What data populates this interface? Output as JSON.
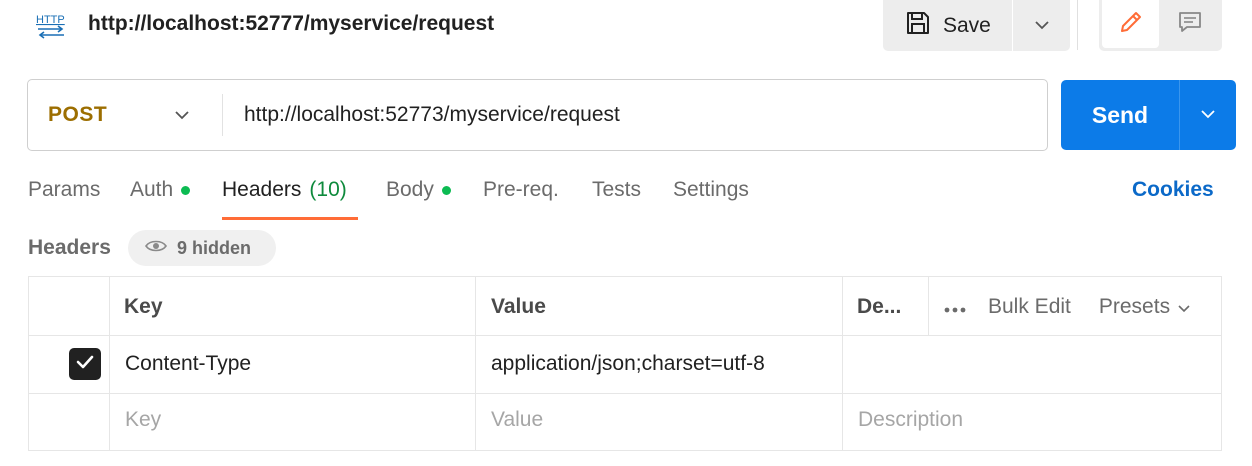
{
  "top": {
    "icon": "http-request-icon",
    "icon_text": "HTTP",
    "title": "http://localhost:52777/myservice/request",
    "save_label": "Save"
  },
  "url_bar": {
    "method": "POST",
    "url": "http://localhost:52773/myservice/request",
    "send_label": "Send"
  },
  "tabs": {
    "params": "Params",
    "auth": "Auth",
    "headers": "Headers",
    "headers_count": "(10)",
    "body": "Body",
    "prereq": "Pre-req.",
    "tests": "Tests",
    "settings": "Settings",
    "cookies": "Cookies",
    "active": "headers"
  },
  "headers_section": {
    "label": "Headers",
    "hidden_label": "9 hidden"
  },
  "table": {
    "columns": {
      "key": "Key",
      "value": "Value",
      "description": "De...",
      "bulk_edit": "Bulk Edit",
      "presets": "Presets"
    },
    "rows": [
      {
        "checked": true,
        "key": "Content-Type",
        "value": "application/json;charset=utf-8",
        "description": ""
      }
    ],
    "placeholders": {
      "key": "Key",
      "value": "Value",
      "description": "Description"
    }
  },
  "colors": {
    "method": "#9c6e00",
    "send": "#0c7be8",
    "active_tab_underline": "#ff6c37",
    "status_dot": "#0cbb52",
    "cookies_link": "#0b69c8"
  }
}
